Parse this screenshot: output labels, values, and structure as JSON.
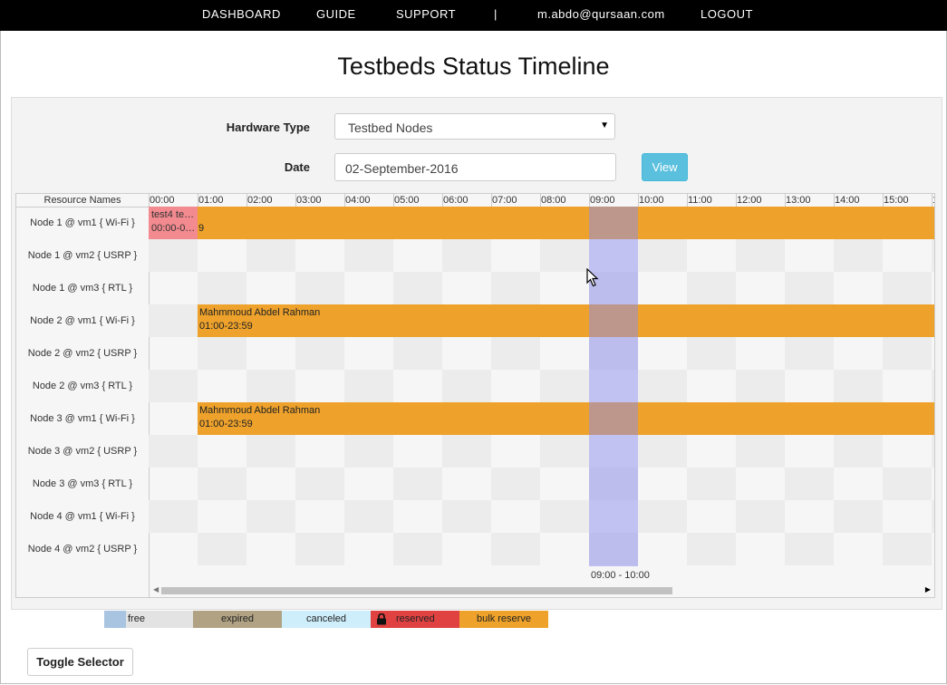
{
  "nav": {
    "dashboard": "DASHBOARD",
    "guide": "GUIDE",
    "support": "SUPPORT",
    "separator": "|",
    "user": "m.abdo@qursaan.com",
    "logout": "LOGOUT"
  },
  "page_title": "Testbeds Status Timeline",
  "form": {
    "hardware_label": "Hardware Type",
    "hardware_value": "Testbed Nodes",
    "date_label": "Date",
    "date_value": "02-September-2016",
    "view_button": "View"
  },
  "timeline": {
    "resource_header": "Resource Names",
    "hours": [
      "00:00",
      "01:00",
      "02:00",
      "03:00",
      "04:00",
      "05:00",
      "06:00",
      "07:00",
      "08:00",
      "09:00",
      "10:00",
      "11:00",
      "12:00",
      "13:00",
      "14:00",
      "15:00",
      "1"
    ],
    "resources": [
      "Node 1 @ vm1 { Wi-Fi }",
      "Node 1 @ vm2 { USRP }",
      "Node 1 @ vm3 { RTL }",
      "Node 2 @ vm1 { Wi-Fi }",
      "Node 2 @ vm2 { USRP }",
      "Node 2 @ vm3 { RTL }",
      "Node 3 @ vm1 { Wi-Fi }",
      "Node 3 @ vm2 { USRP }",
      "Node 3 @ vm3 { RTL }",
      "Node 4 @ vm1 { Wi-Fi }",
      "Node 4 @ vm2 { USRP }"
    ],
    "reservations": [
      {
        "resource": "Node 1 @ vm1 { Wi-Fi }",
        "type": "expired",
        "line1": "test4 te…",
        "line2": "00:00-0…"
      },
      {
        "resource": "Node 1 @ vm1 { Wi-Fi }",
        "type": "bulk reserve",
        "line1": "",
        "line2": "9"
      },
      {
        "resource": "Node 2 @ vm1 { Wi-Fi }",
        "type": "bulk reserve",
        "line1": "Mahmmoud Abdel Rahman",
        "line2": "01:00-23:59"
      },
      {
        "resource": "Node 3 @ vm1 { Wi-Fi }",
        "type": "bulk reserve",
        "line1": "Mahmmoud Abdel Rahman",
        "line2": "01:00-23:59"
      }
    ],
    "selection_label": "09:00 - 10:00"
  },
  "legend": [
    {
      "label": "free",
      "color": "#ababab"
    },
    {
      "label": "expired",
      "color": "#b0a283"
    },
    {
      "label": "canceled",
      "color": "#cfeefc"
    },
    {
      "label": "reserved",
      "color": "#e04242"
    },
    {
      "label": "bulk reserve",
      "color": "#eea22b"
    }
  ],
  "toggle_button": "Toggle Selector",
  "colors": {
    "accent_info": "#5bc0de",
    "bulk_reserve": "#eea22b",
    "pink_reservation": "#f28a8f",
    "selection": "#8c8cee"
  }
}
